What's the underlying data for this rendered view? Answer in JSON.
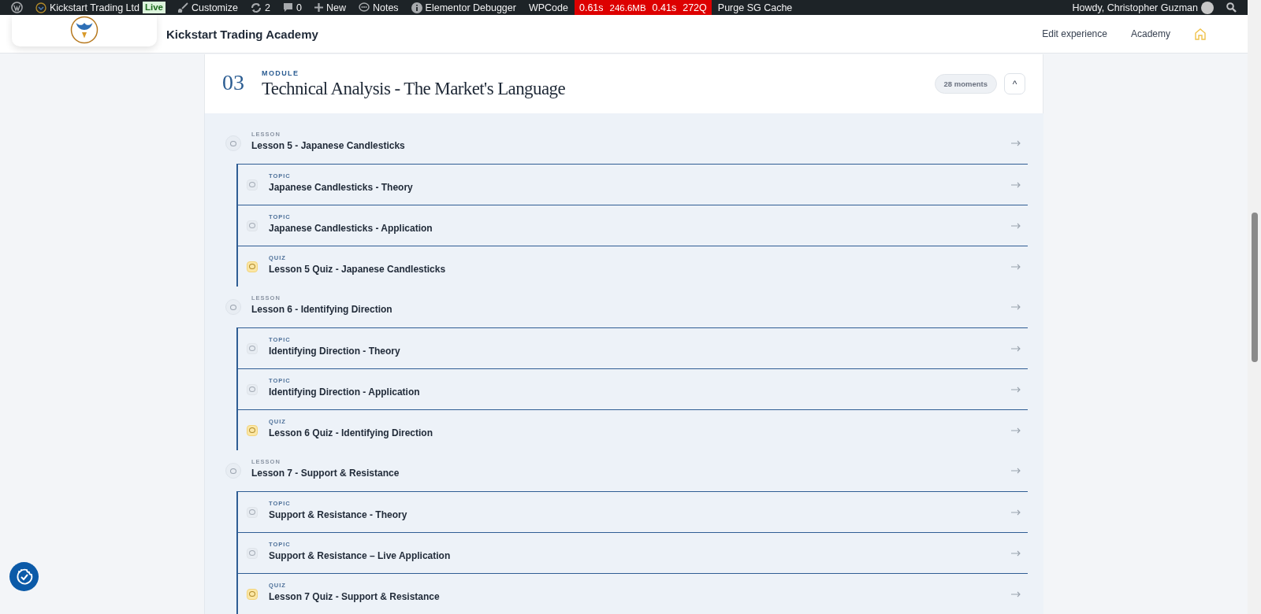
{
  "admin_bar": {
    "site": "Kickstart Trading Ltd",
    "live_badge": "Live",
    "customize": "Customize",
    "updates": "2",
    "comments": "0",
    "new": "New",
    "notes": "Notes",
    "debugger": "Elementor Debugger",
    "wpcode": "WPCode",
    "query_monitor": [
      "0.61s",
      "246.6MB",
      "0.41s",
      "272Q"
    ],
    "purge": "Purge SG Cache",
    "greeting": "Howdy, Christopher Guzman"
  },
  "header": {
    "title": "Kickstart Trading Academy",
    "nav": [
      "Edit experience",
      "Academy"
    ]
  },
  "module": {
    "number": "03",
    "label": "MODULE",
    "title": "Technical Analysis - The Market's Language",
    "badge": "28 moments",
    "toggle": "^"
  },
  "lessons": [
    {
      "kind": "lesson",
      "label": "LESSON",
      "title": "Lesson 5 - Japanese Candlesticks",
      "children": [
        {
          "kind": "topic",
          "label": "TOPIC",
          "title": "Japanese Candlesticks - Theory"
        },
        {
          "kind": "topic",
          "label": "TOPIC",
          "title": "Japanese Candlesticks - Application"
        },
        {
          "kind": "quiz",
          "label": "QUIZ",
          "title": "Lesson 5 Quiz - Japanese Candlesticks"
        }
      ]
    },
    {
      "kind": "lesson",
      "label": "LESSON",
      "title": "Lesson 6 - Identifying Direction",
      "children": [
        {
          "kind": "topic",
          "label": "TOPIC",
          "title": "Identifying Direction - Theory"
        },
        {
          "kind": "topic",
          "label": "TOPIC",
          "title": "Identifying Direction - Application"
        },
        {
          "kind": "quiz",
          "label": "QUIZ",
          "title": "Lesson 6 Quiz - Identifying Direction"
        }
      ]
    },
    {
      "kind": "lesson",
      "label": "LESSON",
      "title": "Lesson 7 - Support & Resistance",
      "children": [
        {
          "kind": "topic",
          "label": "TOPIC",
          "title": "Support & Resistance - Theory"
        },
        {
          "kind": "topic",
          "label": "TOPIC",
          "title": "Support & Resistance – Live Application"
        },
        {
          "kind": "quiz",
          "label": "QUIZ",
          "title": "Lesson 7 Quiz - Support & Resistance"
        }
      ]
    }
  ]
}
